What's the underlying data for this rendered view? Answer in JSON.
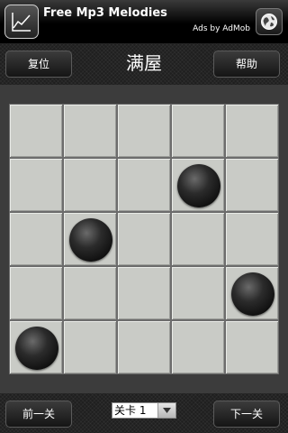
{
  "ad": {
    "title": "Free Mp3 Melodies",
    "byline": "Ads by AdMob",
    "icon": "chart-line-icon",
    "action_icon": "globe-icon"
  },
  "toolbar": {
    "reset_label": "复位",
    "title": "满屋",
    "help_label": "帮助"
  },
  "board": {
    "rows": 5,
    "cols": 5,
    "cell_color": "#c9cbc6",
    "stones": [
      {
        "row": 1,
        "col": 3
      },
      {
        "row": 2,
        "col": 1
      },
      {
        "row": 3,
        "col": 4
      },
      {
        "row": 4,
        "col": 0
      }
    ]
  },
  "bottom": {
    "prev_label": "前一关",
    "level_value": "关卡 1",
    "next_label": "下一关"
  }
}
